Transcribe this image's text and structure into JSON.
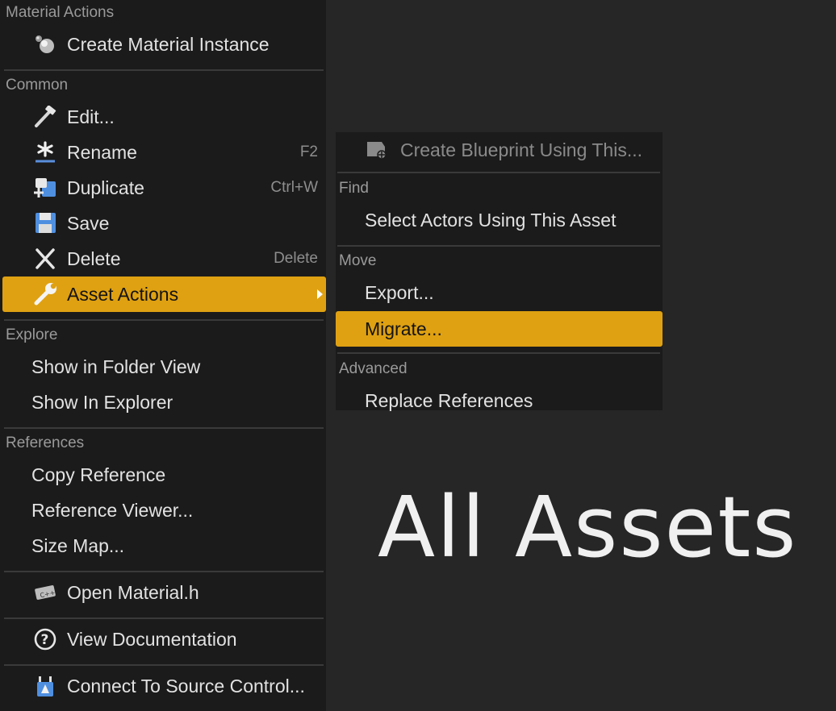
{
  "main_menu": {
    "sections": {
      "material_actions": "Material Actions",
      "common": "Common",
      "explore": "Explore",
      "references": "References"
    },
    "items": {
      "create_material_instance": "Create Material Instance",
      "edit": "Edit...",
      "rename": "Rename",
      "rename_shortcut": "F2",
      "duplicate": "Duplicate",
      "duplicate_shortcut": "Ctrl+W",
      "save": "Save",
      "delete": "Delete",
      "delete_shortcut": "Delete",
      "asset_actions": "Asset Actions",
      "show_in_folder_view": "Show in Folder View",
      "show_in_explorer": "Show In Explorer",
      "copy_reference": "Copy Reference",
      "reference_viewer": "Reference Viewer...",
      "size_map": "Size Map...",
      "open_material_h": "Open Material.h",
      "view_documentation": "View Documentation",
      "connect_source_control": "Connect To Source Control..."
    }
  },
  "sub_menu": {
    "sections": {
      "find": "Find",
      "move": "Move",
      "advanced": "Advanced"
    },
    "items": {
      "create_blueprint": "Create Blueprint Using This...",
      "select_actors": "Select Actors Using This Asset",
      "export": "Export...",
      "migrate": "Migrate...",
      "replace_references": "Replace References"
    }
  },
  "overlay_title": "All Assets",
  "colors": {
    "highlight": "#dfa112",
    "menu_bg": "#1b1b1b",
    "page_bg": "#262626"
  }
}
